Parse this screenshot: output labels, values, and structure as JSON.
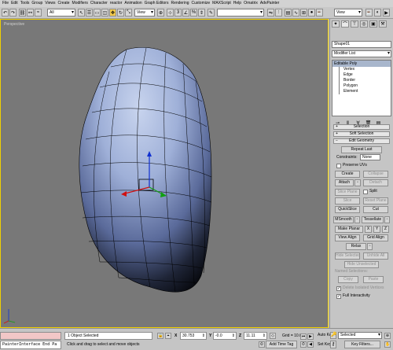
{
  "menu": [
    "File",
    "Edit",
    "Tools",
    "Group",
    "Views",
    "Create",
    "Modifiers",
    "Character",
    "reactor",
    "Animation",
    "Graph Editors",
    "Rendering",
    "Customize",
    "MAXScript",
    "Help",
    "Ornatrix",
    "AdvPainter"
  ],
  "toolbar": {
    "selection_filter": "All",
    "ref_coord": "View",
    "named_sel": "",
    "right_view": "View"
  },
  "viewport": {
    "label": "Perspective"
  },
  "command_panel": {
    "object_name": "Shape01",
    "modifier_list": "Modifier List",
    "stack_main": "Editable Poly",
    "stack_subs": [
      "Vertex",
      "Edge",
      "Border",
      "Polygon",
      "Element"
    ],
    "rollouts": {
      "selection": "Selection",
      "soft_selection": "Soft Selection",
      "edit_geometry": "Edit Geometry"
    },
    "repeat_last": "Repeat Last",
    "constraints_label": "Constraints:",
    "constraints_value": "None",
    "preserve_uvs": "Preserve UVs",
    "create": "Create",
    "collapse": "Collapse",
    "attach": "Attach",
    "detach": "Detach",
    "slice_plane": "Slice Plane",
    "split": "Split",
    "slice": "Slice",
    "reset_plane": "Reset Plane",
    "quickslice": "QuickSlice",
    "cut": "Cut",
    "msmooth": "MSmooth",
    "tessellate": "Tessellate",
    "make_planar": "Make Planar",
    "x": "X",
    "y": "Y",
    "z": "Z",
    "view_align": "View Align",
    "grid_align": "Grid Align",
    "relax": "Relax",
    "hide_selected": "Hide Selected",
    "unhide_all": "Unhide All",
    "hide_unselected": "Hide Unselected",
    "named_selections": "Named Selections:",
    "copy": "Copy",
    "paste": "Paste",
    "delete_isolated": "Delete Isolated Vertices",
    "full_interactivity": "Full Interactivity"
  },
  "status": {
    "painter_interface": "PainterInterface End Pa",
    "selected": "1 Object Selected",
    "prompt": "Click and drag to select and move objects",
    "x_label": "X",
    "x_value": "30.753",
    "y_label": "Y",
    "y_value": "-0.0",
    "z_label": "Z",
    "z_value": "11.11",
    "grid": "Grid = 10.0",
    "add_time_tag": "Add Time Tag",
    "auto_key": "Auto Key",
    "set_key": "Set Key",
    "selection_set": "Selected",
    "key_filters": "Key Filters..."
  },
  "colors": {
    "viewport_bg": "#787878",
    "mesh_light": "#b4c3e0",
    "mesh_dark": "#0a0a10",
    "active_border": "#f0d000"
  }
}
